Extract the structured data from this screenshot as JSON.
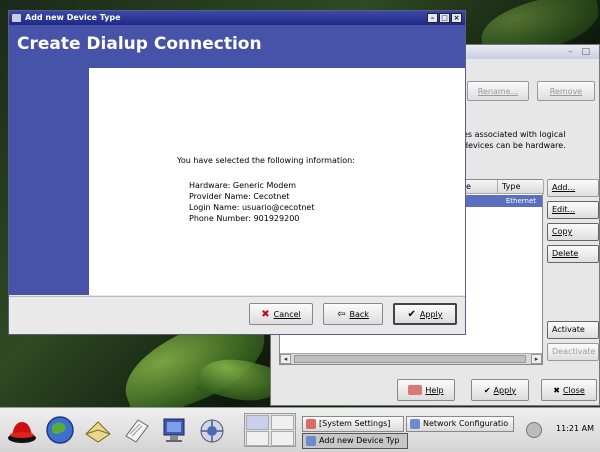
{
  "colors": {
    "dialog_header": "#4753a8",
    "dialog_title_bar": "#27318e",
    "selection": "#5b6fc0",
    "redhat_red": "#cc1111"
  },
  "dialog": {
    "title": "Add new Device Type",
    "header": "Create Dialup Connection",
    "intro": "You have selected the following information:",
    "summary": [
      {
        "label": "Hardware:",
        "value": "Generic Modem"
      },
      {
        "label": "Provider Name:",
        "value": "Cecotnet"
      },
      {
        "label": "Login Name:",
        "value": "usuario@cecotnet"
      },
      {
        "label": "Phone Number:",
        "value": "901929200"
      }
    ],
    "buttons": {
      "cancel": {
        "label": "Cancel",
        "icon": "x-icon"
      },
      "back": {
        "label": "Back",
        "icon": "back-arrow-icon"
      },
      "apply": {
        "label": "Apply",
        "icon": "checkmark-icon"
      }
    }
  },
  "network_window": {
    "toolbar": {
      "rename": "Rename...",
      "remove": "Remove"
    },
    "description": "es associated with logical devices can be hardware.",
    "columns": [
      "e",
      "Type"
    ],
    "rows": [
      {
        "type": "Ethernet"
      }
    ],
    "side_buttons": {
      "add": "Add...",
      "edit": "Edit...",
      "copy": "Copy",
      "delete": "Delete",
      "activate": "Activate",
      "deactivate": "Deactivate"
    },
    "bottom_buttons": {
      "help": "Help",
      "apply": "Apply",
      "close": "Close"
    }
  },
  "taskbar": {
    "launchers": [
      "redhat-icon",
      "browser-globe-icon",
      "mail-icon",
      "document-icon",
      "system-monitor-icon",
      "network-icon"
    ],
    "tasks": [
      {
        "label": "[System Settings]"
      },
      {
        "label": "Network Configuratio"
      },
      {
        "label": "Add new Device Typ"
      }
    ],
    "clock": "11:21 AM"
  }
}
